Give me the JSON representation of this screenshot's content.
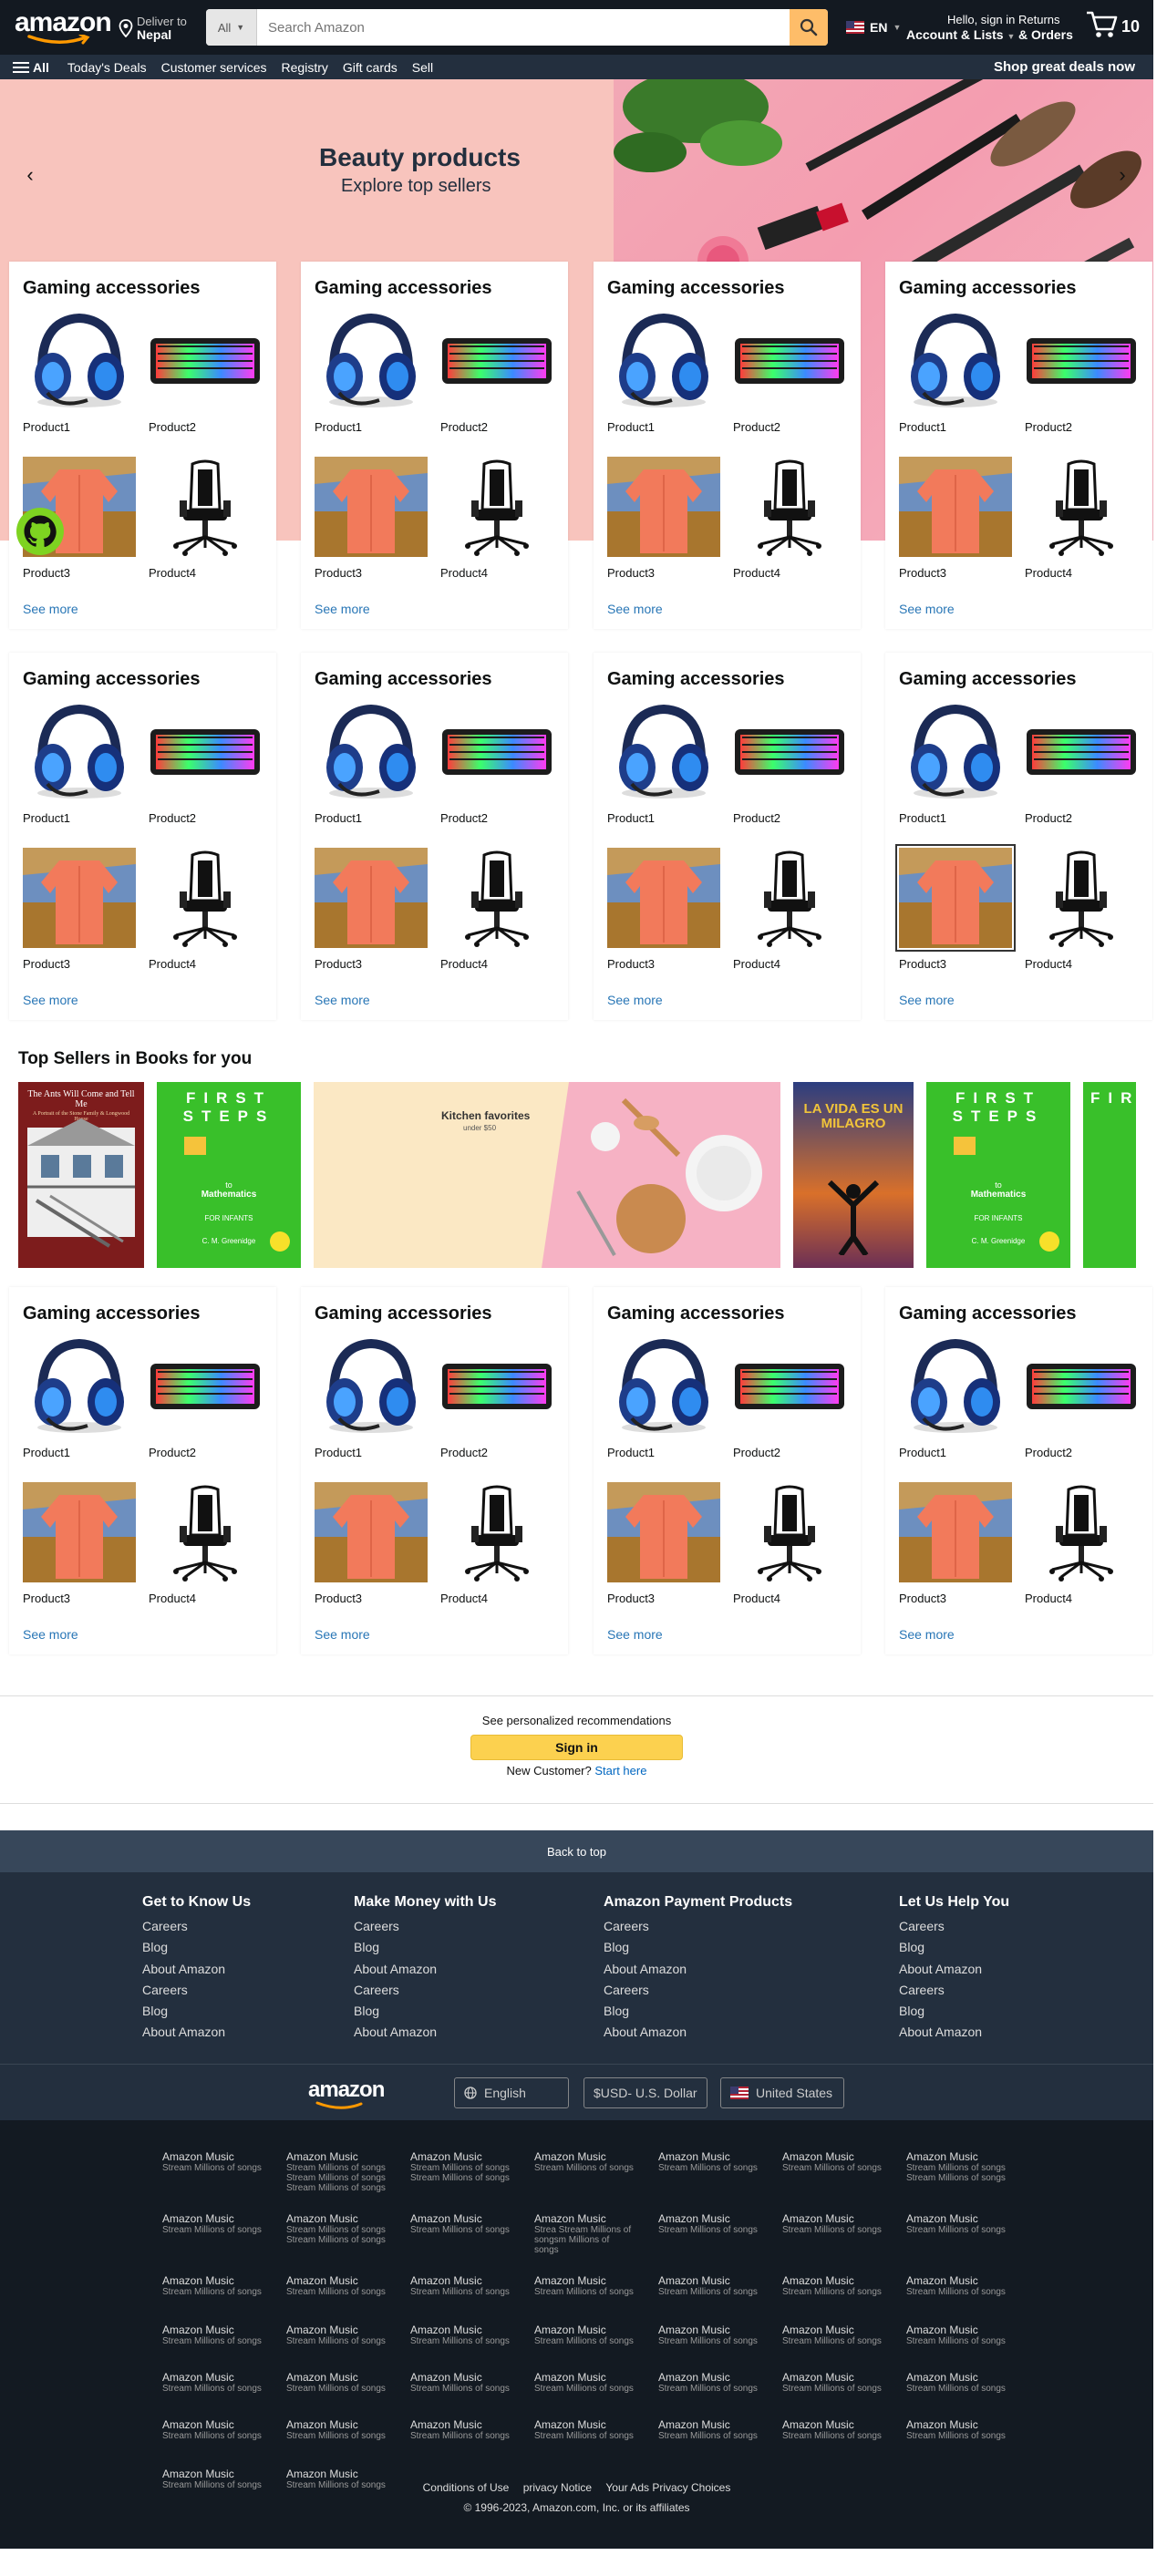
{
  "nav": {
    "logo": "amazon",
    "deliver_line1": "Deliver to",
    "deliver_line2": "Nepal",
    "search_category": "All",
    "search_placeholder": "Search Amazon",
    "language": "EN",
    "account_line1": "Hello, sign in",
    "account_line2": "Account & Lists",
    "returns_line1": "Returns",
    "returns_line2": "& Orders",
    "cart_count": "10"
  },
  "subnav": {
    "all_label": "All",
    "items": [
      "Today's Deals",
      "Customer services",
      "Registry",
      "Gift cards",
      "Sell"
    ],
    "promo": "Shop great deals now"
  },
  "hero": {
    "title": "Beauty products",
    "subtitle": "Explore top sellers"
  },
  "cards": {
    "title": "Gaming accessories",
    "products": [
      "Product1",
      "Product2",
      "Product3",
      "Product4"
    ],
    "see_more": "See more"
  },
  "books": {
    "title": "Top Sellers in Books for you",
    "book1_title": "The Ants Will Come and Tell Me",
    "book1_sub": "A Portrait of the Stone Family & Longwood House",
    "book2_title": "FIRST STEPS",
    "book2_to": "to",
    "book2_sub": "Mathematics",
    "book2_for": "FOR INFANTS",
    "book2_author": "C. M. Greenidge",
    "kitchen_title": "Kitchen favorites",
    "kitchen_sub": "under $50",
    "book4_title": "LA VIDA ES UN MILAGRO"
  },
  "signin": {
    "prompt": "See personalized recommendations",
    "button": "Sign in",
    "new_customer": "New Customer?",
    "start_here": "Start here"
  },
  "footer": {
    "back_to_top": "Back to top",
    "columns": [
      {
        "title": "Get to Know Us",
        "links": [
          "Careers",
          "Blog",
          "About Amazon",
          "Careers",
          "Blog",
          "About Amazon"
        ]
      },
      {
        "title": "Make Money with Us",
        "links": [
          "Careers",
          "Blog",
          "About Amazon",
          "Careers",
          "Blog",
          "About Amazon"
        ]
      },
      {
        "title": "Amazon Payment Products",
        "links": [
          "Careers",
          "Blog",
          "About Amazon",
          "Careers",
          "Blog",
          "About Amazon"
        ]
      },
      {
        "title": "Let Us Help You",
        "links": [
          "Careers",
          "Blog",
          "About Amazon",
          "Careers",
          "Blog",
          "About Amazon"
        ]
      }
    ],
    "logo": "amazon",
    "language": "English",
    "currency": "$USD- U.S. Dollar",
    "country": "United States",
    "music_title": "Amazon Music",
    "music_sub": "Stream Millions of songs",
    "music_sub_long": "Stream Millions of songs Stream Millions of songs Stream Millions of songs",
    "music_sub_mid": "Stream Millions of songs Stream Millions of songs",
    "music_sub_stream": "Strea Stream Millions of songsm Millions of songs",
    "legal": [
      "Conditions of Use",
      "privacy Notice",
      "Your Ads Privacy Choices"
    ],
    "copyright": "© 1996-2023, Amazon.com, Inc. or its affiliates"
  }
}
